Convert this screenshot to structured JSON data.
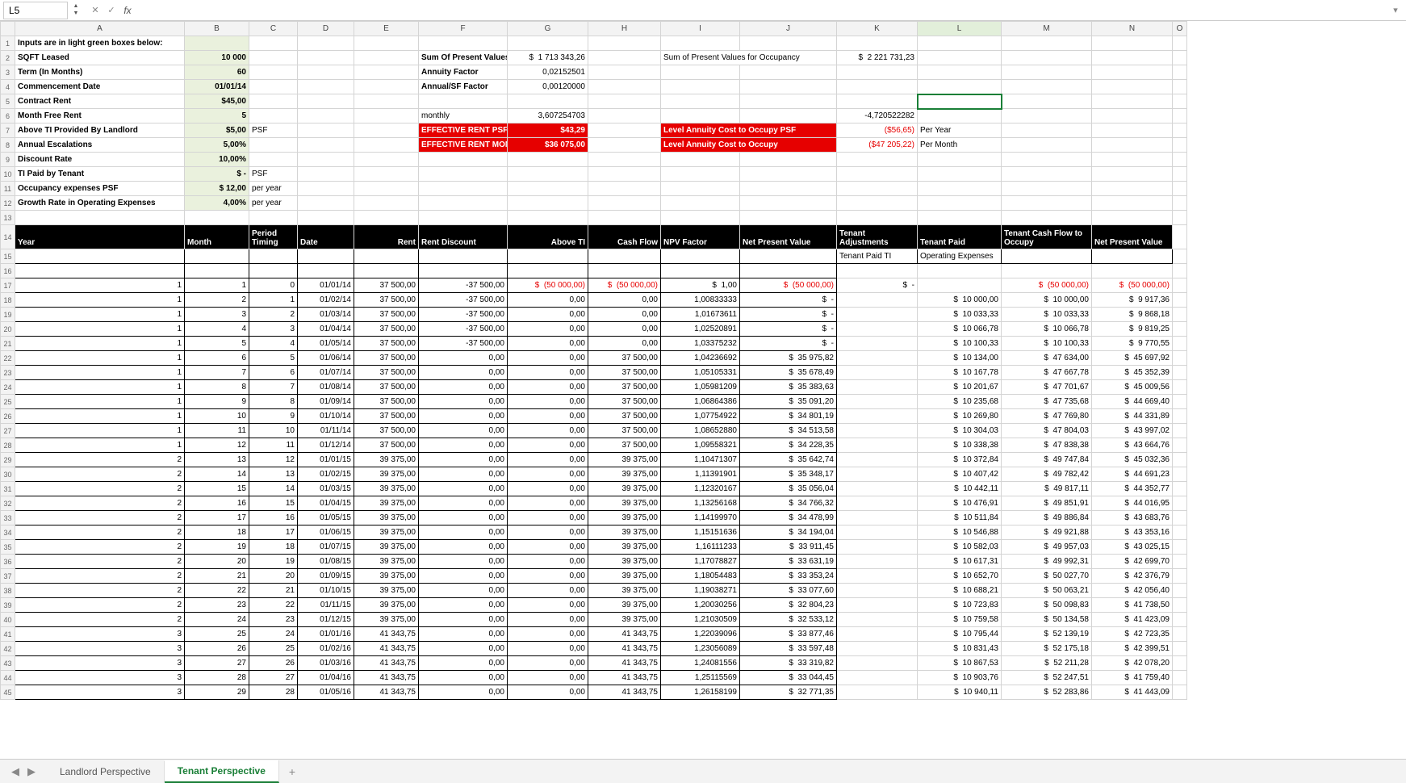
{
  "namebox": "L5",
  "columns": [
    "A",
    "B",
    "C",
    "D",
    "E",
    "F",
    "G",
    "H",
    "I",
    "J",
    "K",
    "L",
    "M",
    "N",
    "O"
  ],
  "inputs_header": "Inputs are in light green boxes below:",
  "inputs": {
    "sqft_label": "SQFT Leased",
    "sqft": "10 000",
    "term_label": "Term (In Months)",
    "term": "60",
    "comm_label": "Commencement Date",
    "comm": "01/01/14",
    "crent_label": "Contract Rent",
    "crent": "$45,00",
    "mfr_label": "Month Free Rent",
    "mfr": "5",
    "ti_label": "Above TI Provided By Landlord",
    "ti": "$5,00",
    "ti_unit": "PSF",
    "esc_label": "Annual Escalations",
    "esc": "5,00%",
    "disc_label": "Discount Rate",
    "disc": "10,00%",
    "tip_label": "TI Paid by Tenant",
    "tip": "$        -",
    "tip_unit": "PSF",
    "occ_label": "Occupancy expenses PSF",
    "occ": "$      12,00",
    "occ_unit": "per year",
    "grow_label": "Growth Rate in Operating Expenses",
    "grow": "4,00%",
    "grow_unit": "per year"
  },
  "calc": {
    "spv_label": "Sum Of Present Values",
    "spv_cur": "$",
    "spv": "1 713 343,26",
    "af_label": "Annuity Factor",
    "af": "0,02152501",
    "asf_label": "Annual/SF Factor",
    "asf": "0,00120000",
    "monthly_label": "monthly",
    "monthly": "3,607254703",
    "erpsf_label": "EFFECTIVE RENT PSF",
    "erpsf": "$43,29",
    "erm_label": "EFFECTIVE RENT MONTHLY",
    "erm": "$36 075,00",
    "spvo_label": "Sum of Present Values for Occupancy",
    "spvo_cur": "$",
    "spvo": "2 221 731,23",
    "k6": "-4,720522282",
    "lacopsf_label": "Level Annuity Cost to Occupy PSF",
    "lacopsf": "($56,65)",
    "lacopsf_u": "Per Year",
    "laco_label": "Level Annuity Cost to Occupy",
    "laco": "($47 205,22)",
    "laco_u": "Per Month"
  },
  "table_headers": {
    "year": "Year",
    "month": "Month",
    "pt": "Period Timing",
    "date": "Date",
    "rent": "Rent",
    "rd": "Rent Discount",
    "ati": "Above TI",
    "cf": "Cash Flow",
    "npvf": "NPV Factor",
    "npv": "Net Present Value",
    "tadj": "Tenant Adjustments",
    "tpaid": "Tenant Paid",
    "tcfto": "Tenant Cash Flow to Occupy",
    "npv2": "Net Present Value",
    "sub_k": "Tenant Paid TI",
    "sub_l": "Operating Expenses"
  },
  "rows": [
    {
      "y": "1",
      "m": "1",
      "pt": "0",
      "d": "01/01/14",
      "rent": "37 500,00",
      "rd": "-37 500,00",
      "ati_cur": "$",
      "ati": "(50 000,00)",
      "cf_cur": "$",
      "cf": "(50 000,00)",
      "nf_cur": "$",
      "nf": "1,00",
      "nv_cur": "$",
      "nv": "(50 000,00)",
      "tadj_cur": "$",
      "tadj": "-",
      "tp_cur": "",
      "tp": "",
      "to_cur": "$",
      "to": "(50 000,00)",
      "npv2_cur": "$",
      "npv2": "(50 000,00)"
    },
    {
      "y": "1",
      "m": "2",
      "pt": "1",
      "d": "01/02/14",
      "rent": "37 500,00",
      "rd": "-37 500,00",
      "ati": "0,00",
      "cf": "0,00",
      "nf": "1,00833333",
      "nv_cur": "$",
      "nv": "-",
      "tp_cur": "$",
      "tp": "10 000,00",
      "to_cur": "$",
      "to": "10 000,00",
      "npv2_cur": "$",
      "npv2": "9 917,36"
    },
    {
      "y": "1",
      "m": "3",
      "pt": "2",
      "d": "01/03/14",
      "rent": "37 500,00",
      "rd": "-37 500,00",
      "ati": "0,00",
      "cf": "0,00",
      "nf": "1,01673611",
      "nv_cur": "$",
      "nv": "-",
      "tp_cur": "$",
      "tp": "10 033,33",
      "to_cur": "$",
      "to": "10 033,33",
      "npv2_cur": "$",
      "npv2": "9 868,18"
    },
    {
      "y": "1",
      "m": "4",
      "pt": "3",
      "d": "01/04/14",
      "rent": "37 500,00",
      "rd": "-37 500,00",
      "ati": "0,00",
      "cf": "0,00",
      "nf": "1,02520891",
      "nv_cur": "$",
      "nv": "-",
      "tp_cur": "$",
      "tp": "10 066,78",
      "to_cur": "$",
      "to": "10 066,78",
      "npv2_cur": "$",
      "npv2": "9 819,25"
    },
    {
      "y": "1",
      "m": "5",
      "pt": "4",
      "d": "01/05/14",
      "rent": "37 500,00",
      "rd": "-37 500,00",
      "ati": "0,00",
      "cf": "0,00",
      "nf": "1,03375232",
      "nv_cur": "$",
      "nv": "-",
      "tp_cur": "$",
      "tp": "10 100,33",
      "to_cur": "$",
      "to": "10 100,33",
      "npv2_cur": "$",
      "npv2": "9 770,55"
    },
    {
      "y": "1",
      "m": "6",
      "pt": "5",
      "d": "01/06/14",
      "rent": "37 500,00",
      "rd": "0,00",
      "ati": "0,00",
      "cf": "37 500,00",
      "nf": "1,04236692",
      "nv_cur": "$",
      "nv": "35 975,82",
      "tp_cur": "$",
      "tp": "10 134,00",
      "to_cur": "$",
      "to": "47 634,00",
      "npv2_cur": "$",
      "npv2": "45 697,92"
    },
    {
      "y": "1",
      "m": "7",
      "pt": "6",
      "d": "01/07/14",
      "rent": "37 500,00",
      "rd": "0,00",
      "ati": "0,00",
      "cf": "37 500,00",
      "nf": "1,05105331",
      "nv_cur": "$",
      "nv": "35 678,49",
      "tp_cur": "$",
      "tp": "10 167,78",
      "to_cur": "$",
      "to": "47 667,78",
      "npv2_cur": "$",
      "npv2": "45 352,39"
    },
    {
      "y": "1",
      "m": "8",
      "pt": "7",
      "d": "01/08/14",
      "rent": "37 500,00",
      "rd": "0,00",
      "ati": "0,00",
      "cf": "37 500,00",
      "nf": "1,05981209",
      "nv_cur": "$",
      "nv": "35 383,63",
      "tp_cur": "$",
      "tp": "10 201,67",
      "to_cur": "$",
      "to": "47 701,67",
      "npv2_cur": "$",
      "npv2": "45 009,56"
    },
    {
      "y": "1",
      "m": "9",
      "pt": "8",
      "d": "01/09/14",
      "rent": "37 500,00",
      "rd": "0,00",
      "ati": "0,00",
      "cf": "37 500,00",
      "nf": "1,06864386",
      "nv_cur": "$",
      "nv": "35 091,20",
      "tp_cur": "$",
      "tp": "10 235,68",
      "to_cur": "$",
      "to": "47 735,68",
      "npv2_cur": "$",
      "npv2": "44 669,40"
    },
    {
      "y": "1",
      "m": "10",
      "pt": "9",
      "d": "01/10/14",
      "rent": "37 500,00",
      "rd": "0,00",
      "ati": "0,00",
      "cf": "37 500,00",
      "nf": "1,07754922",
      "nv_cur": "$",
      "nv": "34 801,19",
      "tp_cur": "$",
      "tp": "10 269,80",
      "to_cur": "$",
      "to": "47 769,80",
      "npv2_cur": "$",
      "npv2": "44 331,89"
    },
    {
      "y": "1",
      "m": "11",
      "pt": "10",
      "d": "01/11/14",
      "rent": "37 500,00",
      "rd": "0,00",
      "ati": "0,00",
      "cf": "37 500,00",
      "nf": "1,08652880",
      "nv_cur": "$",
      "nv": "34 513,58",
      "tp_cur": "$",
      "tp": "10 304,03",
      "to_cur": "$",
      "to": "47 804,03",
      "npv2_cur": "$",
      "npv2": "43 997,02"
    },
    {
      "y": "1",
      "m": "12",
      "pt": "11",
      "d": "01/12/14",
      "rent": "37 500,00",
      "rd": "0,00",
      "ati": "0,00",
      "cf": "37 500,00",
      "nf": "1,09558321",
      "nv_cur": "$",
      "nv": "34 228,35",
      "tp_cur": "$",
      "tp": "10 338,38",
      "to_cur": "$",
      "to": "47 838,38",
      "npv2_cur": "$",
      "npv2": "43 664,76"
    },
    {
      "y": "2",
      "m": "13",
      "pt": "12",
      "d": "01/01/15",
      "rent": "39 375,00",
      "rd": "0,00",
      "ati": "0,00",
      "cf": "39 375,00",
      "nf": "1,10471307",
      "nv_cur": "$",
      "nv": "35 642,74",
      "tp_cur": "$",
      "tp": "10 372,84",
      "to_cur": "$",
      "to": "49 747,84",
      "npv2_cur": "$",
      "npv2": "45 032,36"
    },
    {
      "y": "2",
      "m": "14",
      "pt": "13",
      "d": "01/02/15",
      "rent": "39 375,00",
      "rd": "0,00",
      "ati": "0,00",
      "cf": "39 375,00",
      "nf": "1,11391901",
      "nv_cur": "$",
      "nv": "35 348,17",
      "tp_cur": "$",
      "tp": "10 407,42",
      "to_cur": "$",
      "to": "49 782,42",
      "npv2_cur": "$",
      "npv2": "44 691,23"
    },
    {
      "y": "2",
      "m": "15",
      "pt": "14",
      "d": "01/03/15",
      "rent": "39 375,00",
      "rd": "0,00",
      "ati": "0,00",
      "cf": "39 375,00",
      "nf": "1,12320167",
      "nv_cur": "$",
      "nv": "35 056,04",
      "tp_cur": "$",
      "tp": "10 442,11",
      "to_cur": "$",
      "to": "49 817,11",
      "npv2_cur": "$",
      "npv2": "44 352,77"
    },
    {
      "y": "2",
      "m": "16",
      "pt": "15",
      "d": "01/04/15",
      "rent": "39 375,00",
      "rd": "0,00",
      "ati": "0,00",
      "cf": "39 375,00",
      "nf": "1,13256168",
      "nv_cur": "$",
      "nv": "34 766,32",
      "tp_cur": "$",
      "tp": "10 476,91",
      "to_cur": "$",
      "to": "49 851,91",
      "npv2_cur": "$",
      "npv2": "44 016,95"
    },
    {
      "y": "2",
      "m": "17",
      "pt": "16",
      "d": "01/05/15",
      "rent": "39 375,00",
      "rd": "0,00",
      "ati": "0,00",
      "cf": "39 375,00",
      "nf": "1,14199970",
      "nv_cur": "$",
      "nv": "34 478,99",
      "tp_cur": "$",
      "tp": "10 511,84",
      "to_cur": "$",
      "to": "49 886,84",
      "npv2_cur": "$",
      "npv2": "43 683,76"
    },
    {
      "y": "2",
      "m": "18",
      "pt": "17",
      "d": "01/06/15",
      "rent": "39 375,00",
      "rd": "0,00",
      "ati": "0,00",
      "cf": "39 375,00",
      "nf": "1,15151636",
      "nv_cur": "$",
      "nv": "34 194,04",
      "tp_cur": "$",
      "tp": "10 546,88",
      "to_cur": "$",
      "to": "49 921,88",
      "npv2_cur": "$",
      "npv2": "43 353,16"
    },
    {
      "y": "2",
      "m": "19",
      "pt": "18",
      "d": "01/07/15",
      "rent": "39 375,00",
      "rd": "0,00",
      "ati": "0,00",
      "cf": "39 375,00",
      "nf": "1,16111233",
      "nv_cur": "$",
      "nv": "33 911,45",
      "tp_cur": "$",
      "tp": "10 582,03",
      "to_cur": "$",
      "to": "49 957,03",
      "npv2_cur": "$",
      "npv2": "43 025,15"
    },
    {
      "y": "2",
      "m": "20",
      "pt": "19",
      "d": "01/08/15",
      "rent": "39 375,00",
      "rd": "0,00",
      "ati": "0,00",
      "cf": "39 375,00",
      "nf": "1,17078827",
      "nv_cur": "$",
      "nv": "33 631,19",
      "tp_cur": "$",
      "tp": "10 617,31",
      "to_cur": "$",
      "to": "49 992,31",
      "npv2_cur": "$",
      "npv2": "42 699,70"
    },
    {
      "y": "2",
      "m": "21",
      "pt": "20",
      "d": "01/09/15",
      "rent": "39 375,00",
      "rd": "0,00",
      "ati": "0,00",
      "cf": "39 375,00",
      "nf": "1,18054483",
      "nv_cur": "$",
      "nv": "33 353,24",
      "tp_cur": "$",
      "tp": "10 652,70",
      "to_cur": "$",
      "to": "50 027,70",
      "npv2_cur": "$",
      "npv2": "42 376,79"
    },
    {
      "y": "2",
      "m": "22",
      "pt": "21",
      "d": "01/10/15",
      "rent": "39 375,00",
      "rd": "0,00",
      "ati": "0,00",
      "cf": "39 375,00",
      "nf": "1,19038271",
      "nv_cur": "$",
      "nv": "33 077,60",
      "tp_cur": "$",
      "tp": "10 688,21",
      "to_cur": "$",
      "to": "50 063,21",
      "npv2_cur": "$",
      "npv2": "42 056,40"
    },
    {
      "y": "2",
      "m": "23",
      "pt": "22",
      "d": "01/11/15",
      "rent": "39 375,00",
      "rd": "0,00",
      "ati": "0,00",
      "cf": "39 375,00",
      "nf": "1,20030256",
      "nv_cur": "$",
      "nv": "32 804,23",
      "tp_cur": "$",
      "tp": "10 723,83",
      "to_cur": "$",
      "to": "50 098,83",
      "npv2_cur": "$",
      "npv2": "41 738,50"
    },
    {
      "y": "2",
      "m": "24",
      "pt": "23",
      "d": "01/12/15",
      "rent": "39 375,00",
      "rd": "0,00",
      "ati": "0,00",
      "cf": "39 375,00",
      "nf": "1,21030509",
      "nv_cur": "$",
      "nv": "32 533,12",
      "tp_cur": "$",
      "tp": "10 759,58",
      "to_cur": "$",
      "to": "50 134,58",
      "npv2_cur": "$",
      "npv2": "41 423,09"
    },
    {
      "y": "3",
      "m": "25",
      "pt": "24",
      "d": "01/01/16",
      "rent": "41 343,75",
      "rd": "0,00",
      "ati": "0,00",
      "cf": "41 343,75",
      "nf": "1,22039096",
      "nv_cur": "$",
      "nv": "33 877,46",
      "tp_cur": "$",
      "tp": "10 795,44",
      "to_cur": "$",
      "to": "52 139,19",
      "npv2_cur": "$",
      "npv2": "42 723,35"
    },
    {
      "y": "3",
      "m": "26",
      "pt": "25",
      "d": "01/02/16",
      "rent": "41 343,75",
      "rd": "0,00",
      "ati": "0,00",
      "cf": "41 343,75",
      "nf": "1,23056089",
      "nv_cur": "$",
      "nv": "33 597,48",
      "tp_cur": "$",
      "tp": "10 831,43",
      "to_cur": "$",
      "to": "52 175,18",
      "npv2_cur": "$",
      "npv2": "42 399,51"
    },
    {
      "y": "3",
      "m": "27",
      "pt": "26",
      "d": "01/03/16",
      "rent": "41 343,75",
      "rd": "0,00",
      "ati": "0,00",
      "cf": "41 343,75",
      "nf": "1,24081556",
      "nv_cur": "$",
      "nv": "33 319,82",
      "tp_cur": "$",
      "tp": "10 867,53",
      "to_cur": "$",
      "to": "52 211,28",
      "npv2_cur": "$",
      "npv2": "42 078,20"
    },
    {
      "y": "3",
      "m": "28",
      "pt": "27",
      "d": "01/04/16",
      "rent": "41 343,75",
      "rd": "0,00",
      "ati": "0,00",
      "cf": "41 343,75",
      "nf": "1,25115569",
      "nv_cur": "$",
      "nv": "33 044,45",
      "tp_cur": "$",
      "tp": "10 903,76",
      "to_cur": "$",
      "to": "52 247,51",
      "npv2_cur": "$",
      "npv2": "41 759,40"
    },
    {
      "y": "3",
      "m": "29",
      "pt": "28",
      "d": "01/05/16",
      "rent": "41 343,75",
      "rd": "0,00",
      "ati": "0,00",
      "cf": "41 343,75",
      "nf": "1,26158199",
      "nv_cur": "$",
      "nv": "32 771,35",
      "tp_cur": "$",
      "tp": "10 940,11",
      "to_cur": "$",
      "to": "52 283,86",
      "npv2_cur": "$",
      "npv2": "41 443,09"
    }
  ],
  "tabs": {
    "t1": "Landlord Perspective",
    "t2": "Tenant Perspective"
  }
}
